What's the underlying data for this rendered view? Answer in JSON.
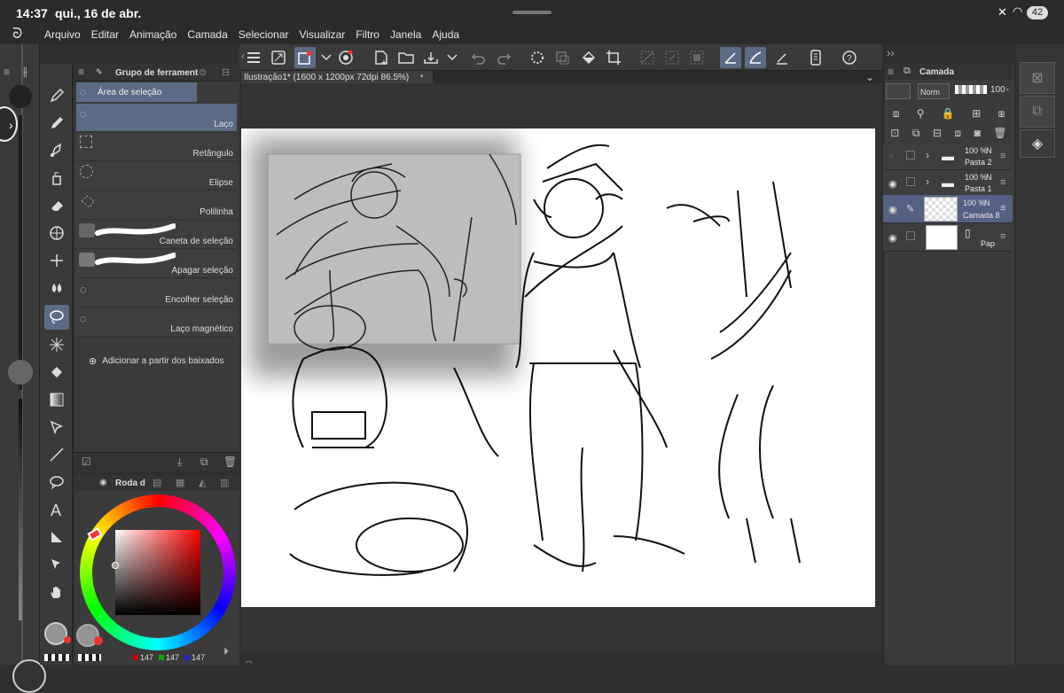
{
  "status": {
    "time": "14:37",
    "date": "qui., 16 de abr.",
    "battery": "42"
  },
  "menu": [
    "Arquivo",
    "Editar",
    "Animação",
    "Camada",
    "Selecionar",
    "Visualizar",
    "Filtro",
    "Janela",
    "Ajuda"
  ],
  "doc_tab": "Ilustração1* (1600 x 1200px 72dpi 86.5%)",
  "sub_tool": {
    "header": "Grupo de ferrament",
    "group": "Área de seleção",
    "items": [
      "Laço",
      "Retângulo",
      "Elipse",
      "Polilinha",
      "Caneta de seleção",
      "Apagar seleção",
      "Encolher seleção",
      "Laço magnético"
    ],
    "add_label": "Adicionar a partir dos baixados"
  },
  "color_panel": {
    "header": "Roda d",
    "r": "147",
    "g": "147",
    "b": "147"
  },
  "layers": {
    "header": "Camada",
    "blend": "Norm",
    "opacity": "100",
    "items": [
      {
        "pct": "100 %",
        "mode": "N",
        "name": "Pasta 2"
      },
      {
        "pct": "100 %",
        "mode": "N",
        "name": "Pasta 1"
      },
      {
        "pct": "100 %",
        "mode": "N",
        "name": "Camada 8"
      },
      {
        "pct": "",
        "mode": "",
        "name": "Pap"
      }
    ]
  },
  "colors": {
    "accent": "#5b6b86",
    "panel": "#3b3b3b",
    "dark": "#2b2b2b"
  }
}
